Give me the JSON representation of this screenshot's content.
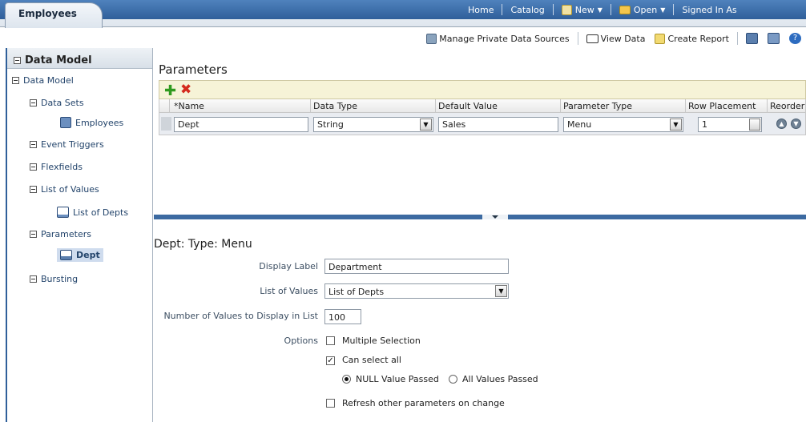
{
  "window": {
    "tab_label": "Employees",
    "globalnav": {
      "home": "Home",
      "catalog": "Catalog",
      "new": "New",
      "open": "Open",
      "signed_in": "Signed In As"
    },
    "toolbar": {
      "manage": "Manage Private Data Sources",
      "view_data": "View Data",
      "create_report": "Create Report"
    }
  },
  "sidebar": {
    "header": "Data Model",
    "root": "Data Model",
    "data_sets": "Data Sets",
    "data_sets_child": "Employees",
    "event_triggers": "Event Triggers",
    "flexfields": "Flexfields",
    "lov": "List of Values",
    "lov_child": "List of Depts",
    "parameters": "Parameters",
    "parameters_child": "Dept",
    "bursting": "Bursting"
  },
  "main": {
    "title": "Parameters",
    "columns": {
      "name": "*Name",
      "data_type": "Data Type",
      "default_value": "Default Value",
      "parameter_type": "Parameter Type",
      "row_placement": "Row Placement",
      "reorder": "Reorder"
    },
    "row": {
      "name": "Dept",
      "data_type": "String",
      "default_value": "Sales",
      "parameter_type": "Menu",
      "row_placement": "1"
    }
  },
  "detail": {
    "title": "Dept: Type: Menu",
    "display_label_label": "Display Label",
    "display_label_value": "Department",
    "lov_label": "List of Values",
    "lov_value": "List of Depts",
    "num_values_label": "Number of Values to Display in List",
    "num_values_value": "100",
    "options_label": "Options",
    "multi_select": "Multiple Selection",
    "can_select_all": "Can select all",
    "null_value": "NULL Value Passed",
    "all_values": "All Values Passed",
    "refresh": "Refresh other parameters on change"
  }
}
